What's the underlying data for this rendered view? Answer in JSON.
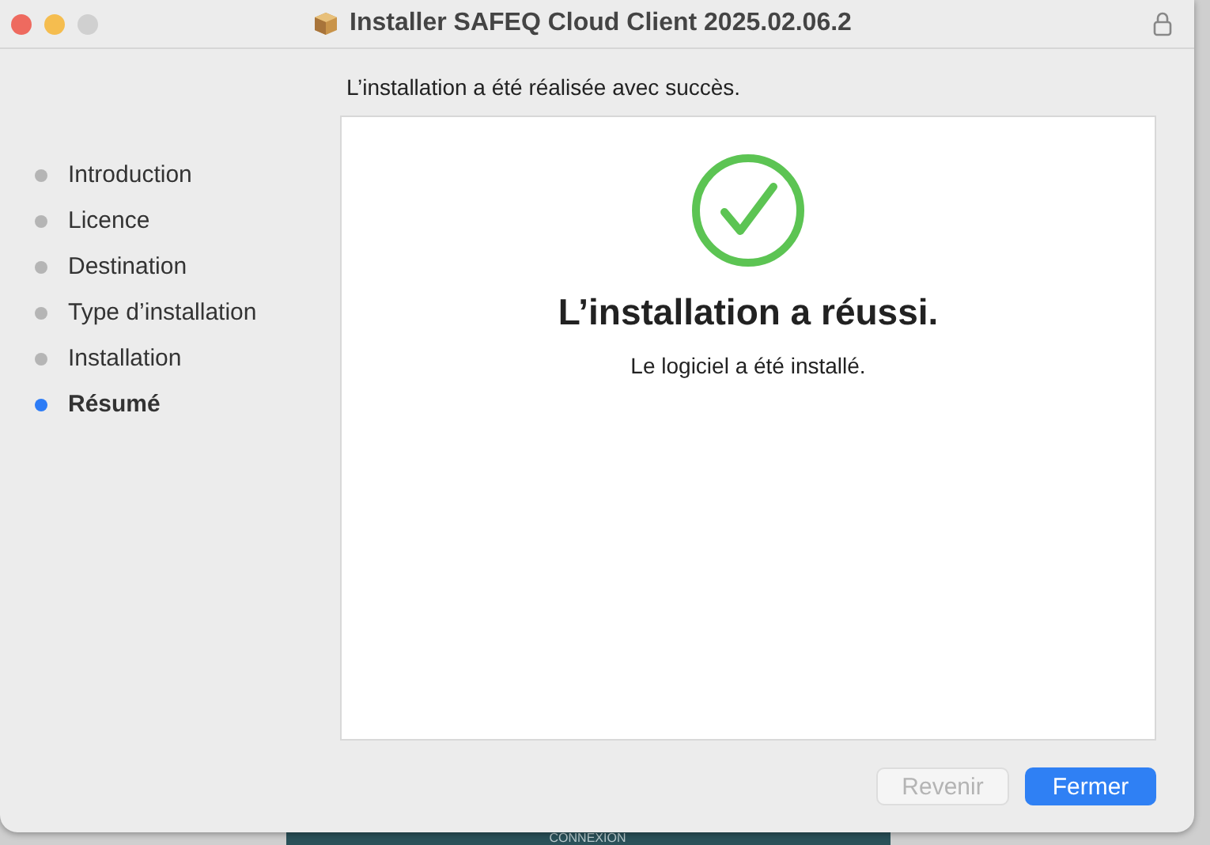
{
  "window": {
    "title": "Installer SAFEQ Cloud Client 2025.02.06.2"
  },
  "header": "L’installation a été réalisée avec succès.",
  "steps": [
    {
      "label": "Introduction",
      "selected": false
    },
    {
      "label": "Licence",
      "selected": false
    },
    {
      "label": "Destination",
      "selected": false
    },
    {
      "label": "Type d’installation",
      "selected": false
    },
    {
      "label": "Installation",
      "selected": false
    },
    {
      "label": "Résumé",
      "selected": true
    }
  ],
  "result": {
    "title": "L’installation a réussi.",
    "message": "Le logiciel a été installé."
  },
  "buttons": [
    {
      "label": "Revenir",
      "kind": "secondary",
      "disabled": true
    },
    {
      "label": "Fermer",
      "kind": "primary",
      "disabled": false
    }
  ],
  "background": {
    "button": "CONNEXION"
  }
}
